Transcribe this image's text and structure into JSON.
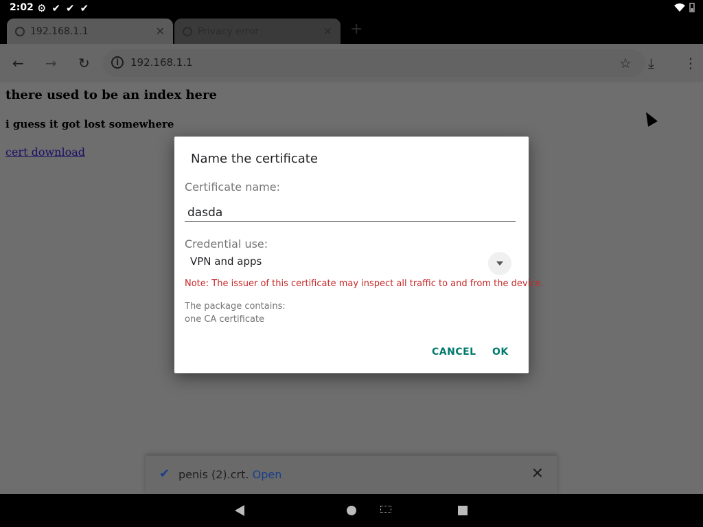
{
  "status": {
    "time": "2:02",
    "icons": [
      "settings-icon",
      "check-icon",
      "check-icon",
      "check-icon"
    ]
  },
  "tabs": [
    {
      "title": "192.168.1.1",
      "active": true
    },
    {
      "title": "Privacy error",
      "active": false
    }
  ],
  "toolbar": {
    "url": "192.168.1.1"
  },
  "page": {
    "heading": "there used to be an index here",
    "subheading": "i guess it got lost somewhere",
    "link": "cert download"
  },
  "dialog": {
    "title": "Name the certificate",
    "cert_name_label": "Certificate name:",
    "cert_name_value": "dasda",
    "credential_use_label": "Credential use:",
    "credential_use_value": "VPN and apps",
    "note": "Note: The issuer of this certificate may inspect all traffic to and from the device.",
    "package_label": "The package contains:",
    "package_value": "one CA certificate",
    "cancel_label": "CANCEL",
    "ok_label": "OK"
  },
  "download": {
    "filename": "penis (2).crt.",
    "open_label": "Open"
  },
  "colors": {
    "accent": "#00796b",
    "warning": "#c62828",
    "link": "#1a3f8a"
  }
}
